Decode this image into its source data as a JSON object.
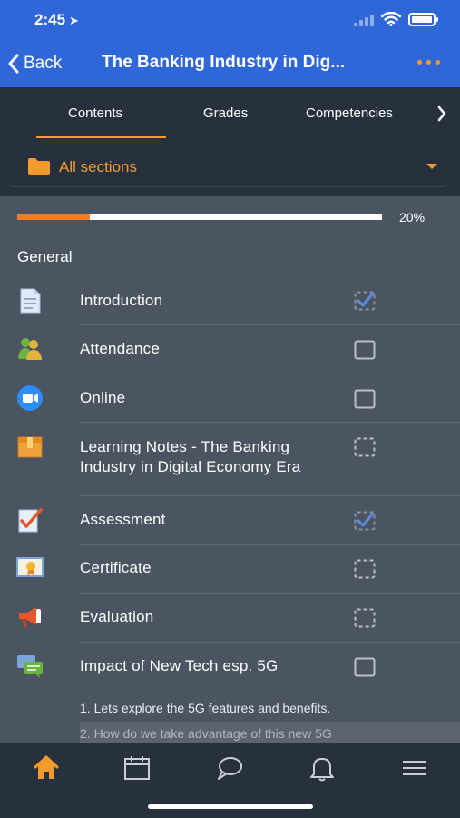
{
  "status_bar": {
    "time": "2:45",
    "location_arrow": "➤"
  },
  "nav": {
    "back_label": "Back",
    "title": "The Banking Industry in Dig...",
    "more_icon": "more-dots-icon"
  },
  "tabs": [
    {
      "label": "Contents",
      "active": true
    },
    {
      "label": "Grades",
      "active": false
    },
    {
      "label": "Competencies",
      "active": false
    }
  ],
  "section_selector": {
    "label": "All sections",
    "icon": "folder-icon"
  },
  "progress": {
    "value": 0.2,
    "label": "20%"
  },
  "section_title": "General",
  "items": [
    {
      "label": "Introduction",
      "icon": "page-icon",
      "completion": "auto-complete"
    },
    {
      "label": "Attendance",
      "icon": "attendance-icon",
      "completion": "manual-incomplete"
    },
    {
      "label": "Online",
      "icon": "video-icon",
      "completion": "manual-incomplete"
    },
    {
      "label": "Learning Notes - The Banking Industry in Digital Economy Era",
      "icon": "box-icon",
      "completion": "auto-incomplete"
    },
    {
      "label": "Assessment",
      "icon": "quiz-icon",
      "completion": "auto-complete"
    },
    {
      "label": "Certificate",
      "icon": "certificate-icon",
      "completion": "auto-incomplete"
    },
    {
      "label": "Evaluation",
      "icon": "megaphone-icon",
      "completion": "auto-incomplete"
    },
    {
      "label": "Impact of New Tech esp. 5G",
      "icon": "forum-icon",
      "completion": "manual-incomplete"
    }
  ],
  "forum_description": {
    "line1": "1. Lets explore the 5G features and benefits.",
    "line2": "2. How do we take advantage of this new 5G"
  },
  "bottom_nav": [
    "home-icon",
    "calendar-icon",
    "messages-icon",
    "notifications-icon",
    "menu-icon"
  ],
  "colors": {
    "accent": "#f59a2c",
    "header": "#2f66d8",
    "dark": "#27313d",
    "body": "#4b5561",
    "check": "#5a8be0"
  }
}
